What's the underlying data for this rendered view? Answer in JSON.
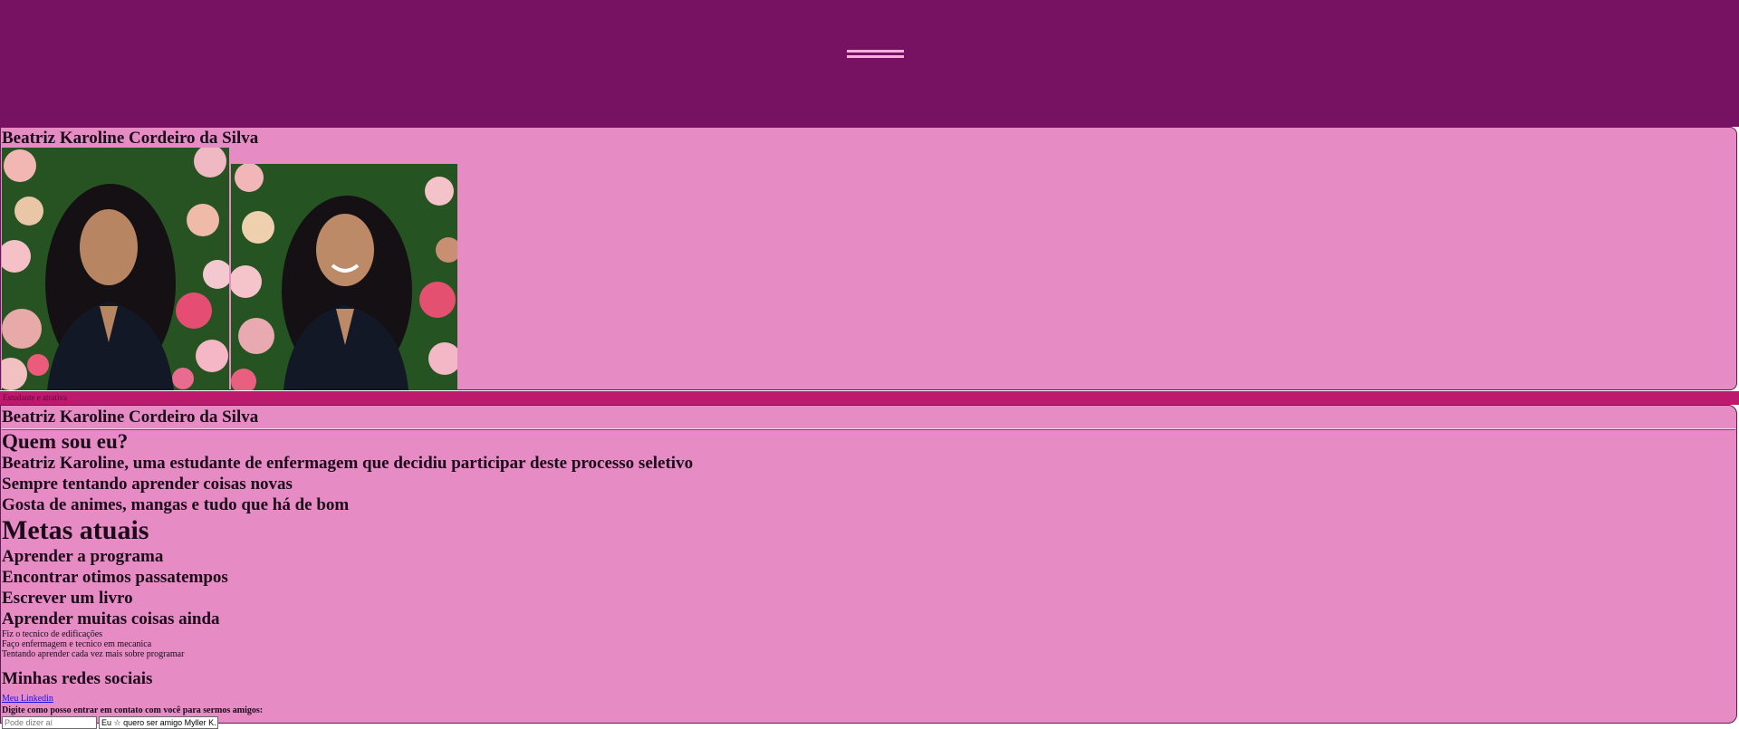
{
  "header": {
    "menu_icon": "hamburger-icon"
  },
  "profile": {
    "name": "Beatriz Karoline Cordeiro da Silva",
    "photos": [
      "photo-portrait-flowers-left",
      "photo-portrait-flowers-right"
    ],
    "caption": "Estudante e atrativa"
  },
  "about": {
    "name": "Beatriz Karoline Cordeiro da Silva",
    "who_title": "Quem sou eu?",
    "who_items": [
      "Beatriz Karoline, uma estudante de enfermagem que decidiu participar deste processo seletivo",
      "Sempre tentando aprender coisas novas",
      "Gosta de animes, mangas e tudo que há de bom"
    ],
    "goals_title": "Metas atuais",
    "goals_items": [
      "Aprender a programa",
      "Encontrar otimos passatempos",
      "Escrever um livro",
      "Aprender muitas coisas ainda"
    ],
    "notes": [
      "Fiz o tecnico de edificações",
      "Faço enfermagem e tecnico em mecanica",
      "Tentando aprender cada vez mais sobre programar"
    ],
    "social_title": "Minhas redes sociais",
    "linkedin_label": "Meu Linkedin",
    "contact_label": "Digite como posso entrar em contato com você para sermos amigos:",
    "input1_placeholder": "Pode dizer aí",
    "input2_value": "Eu ☆ quero ser amigo Myller K.C.S"
  },
  "colors": {
    "header_bg": "#771263",
    "panel_bg": "#e68bc3",
    "strip_bg": "#bd196d",
    "link": "#1a12e8"
  }
}
